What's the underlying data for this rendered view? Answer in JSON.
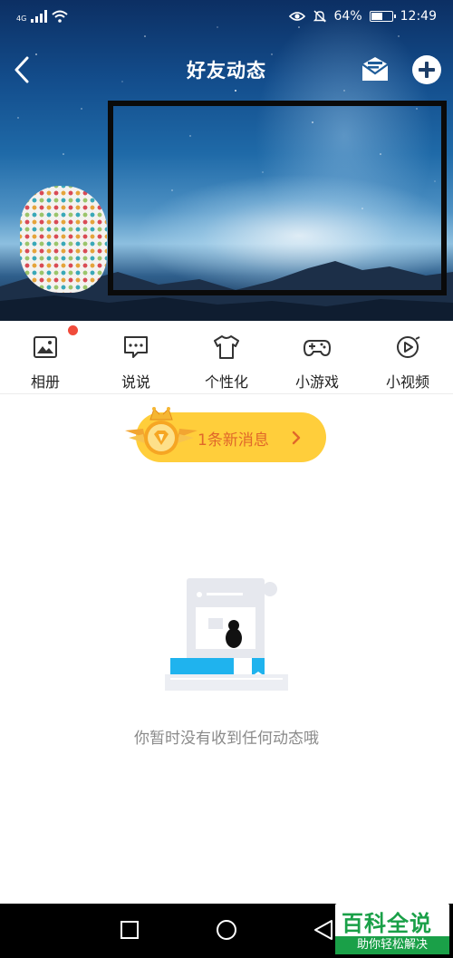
{
  "status_bar": {
    "network": "4G",
    "battery_percent": "64%",
    "battery_level": 0.64,
    "time": "12:49"
  },
  "header": {
    "title": "好友动态"
  },
  "shortcuts": [
    {
      "label": "相册",
      "icon": "photo-album-icon",
      "has_badge": true
    },
    {
      "label": "说说",
      "icon": "chat-bubble-icon",
      "has_badge": false
    },
    {
      "label": "个性化",
      "icon": "tshirt-icon",
      "has_badge": false
    },
    {
      "label": "小游戏",
      "icon": "gamepad-icon",
      "has_badge": false
    },
    {
      "label": "小视频",
      "icon": "play-circle-icon",
      "has_badge": false
    }
  ],
  "new_message": {
    "label": "1条新消息"
  },
  "empty_state": {
    "text": "你暂时没有收到任何动态哦"
  },
  "watermark": {
    "main": "百科全说",
    "sub": "助你轻松解决"
  },
  "colors": {
    "badge_red": "#f04b3b",
    "pill_yellow": "#ffce3b",
    "pill_text": "#e0682a",
    "watermark_green": "#1aa048",
    "accent_blue": "#1fb3ee"
  }
}
